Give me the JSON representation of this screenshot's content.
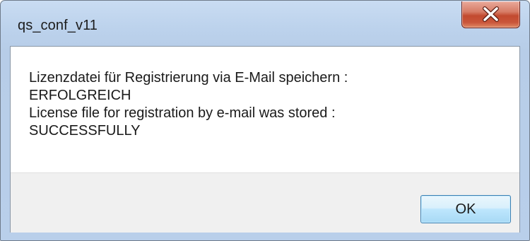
{
  "window": {
    "title": "qs_conf_v11"
  },
  "titlebar": {
    "close_icon": "close-icon"
  },
  "message": {
    "lines": [
      "Lizenzdatei für Registrierung via E-Mail speichern :",
      "ERFOLGREICH",
      "License file for registration by e-mail was stored :",
      "SUCCESSFULLY"
    ]
  },
  "footer": {
    "ok_label": "OK"
  },
  "colors": {
    "frame": "#b9cfea",
    "close_button": "#c9553a",
    "ok_button_border": "#3c7fb1",
    "footer_bg": "#f0f0f0"
  }
}
